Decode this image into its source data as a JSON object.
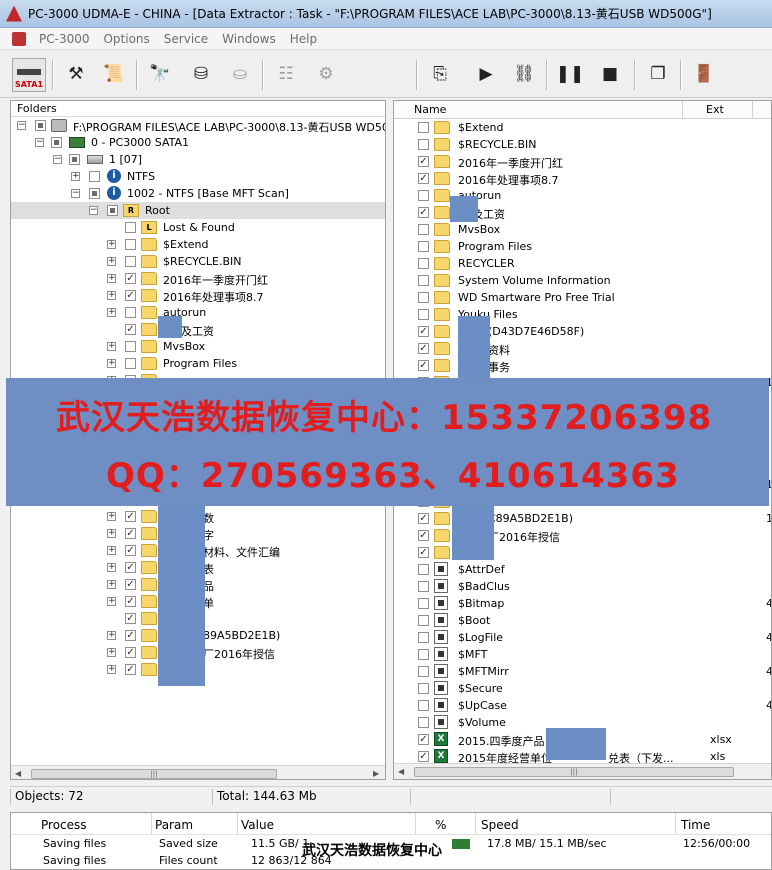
{
  "window": {
    "title": "PC-3000 UDMA-E - CHINA - [Data Extractor : Task - \"F:\\PROGRAM FILES\\ACE LAB\\PC-3000\\8.13-黄石USB WD500G\"]"
  },
  "menu": {
    "app_name": "PC-3000",
    "items": [
      "Options",
      "Service",
      "Windows",
      "Help"
    ]
  },
  "toolbar": {
    "sata_label": "SATA1"
  },
  "folders": {
    "header": "Folders",
    "rows": [
      {
        "label": "F:\\PROGRAM FILES\\ACE LAB\\PC-3000\\8.13-黄石USB WD500"
      },
      {
        "label": "0 - PC3000 SATA1"
      },
      {
        "label": "1 [07]"
      },
      {
        "label": "NTFS"
      },
      {
        "label": "1002 - NTFS [Base MFT Scan]"
      },
      {
        "label": "Root"
      },
      {
        "label": "Lost & Found"
      },
      {
        "label": "$Extend"
      },
      {
        "label": "$RECYCLE.BIN"
      },
      {
        "label": "2016年一季度开门红"
      },
      {
        "label": "2016年处理事项8.7"
      },
      {
        "label": "autorun"
      },
      {
        "label": "及工资"
      },
      {
        "label": "MvsBox"
      },
      {
        "label": "Program Files"
      },
      {
        "label": ""
      },
      {
        "label": ""
      },
      {
        "label": ""
      },
      {
        "label": ""
      },
      {
        "label": ""
      },
      {
        "label": ""
      },
      {
        "label": ""
      },
      {
        "label": ""
      },
      {
        "label": "数"
      },
      {
        "label": "字"
      },
      {
        "label": "材料、文件汇编"
      },
      {
        "label": "表"
      },
      {
        "label": "品"
      },
      {
        "label": "单"
      },
      {
        "label": ""
      },
      {
        "label": "89A5BD2E1B)"
      },
      {
        "label": "厂2016年授信"
      },
      {
        "label": ""
      }
    ]
  },
  "filelist": {
    "col_name": "Name",
    "col_ext": "Ext",
    "rows": [
      {
        "name": "$Extend",
        "ext": "",
        "edge": ""
      },
      {
        "name": "$RECYCLE.BIN",
        "ext": "",
        "edge": ""
      },
      {
        "name": "2016年一季度开门红",
        "ext": "",
        "edge": ""
      },
      {
        "name": "2016年处理事项8.7",
        "ext": "",
        "edge": ""
      },
      {
        "name": "autorun",
        "ext": "",
        "edge": ""
      },
      {
        "name": "及工资",
        "ext": "",
        "edge": ""
      },
      {
        "name": "MvsBox",
        "ext": "",
        "edge": ""
      },
      {
        "name": "Program Files",
        "ext": "",
        "edge": ""
      },
      {
        "name": "RECYCLER",
        "ext": "",
        "edge": ""
      },
      {
        "name": "System Volume Information",
        "ext": "",
        "edge": ""
      },
      {
        "name": "WD Smartware Pro Free Trial",
        "ext": "",
        "edge": ""
      },
      {
        "name": "Youku Files",
        "ext": "",
        "edge": ""
      },
      {
        "name": "(D43D7E46D58F)",
        "ext": "",
        "edge": ""
      },
      {
        "name": "资料",
        "ext": "",
        "edge": ""
      },
      {
        "name": "事务",
        "ext": "",
        "edge": ""
      },
      {
        "name": "",
        "ext": "",
        "edge": "1"
      },
      {
        "name": "",
        "ext": "",
        "edge": ""
      },
      {
        "name": "",
        "ext": "",
        "edge": ""
      },
      {
        "name": "",
        "ext": "",
        "edge": ""
      },
      {
        "name": "",
        "ext": "",
        "edge": ""
      },
      {
        "name": "",
        "ext": "",
        "edge": ""
      },
      {
        "name": "",
        "ext": "",
        "edge": "1"
      },
      {
        "name": "",
        "ext": "",
        "edge": ""
      },
      {
        "name": "C89A5BD2E1B)",
        "ext": "",
        "edge": "1"
      },
      {
        "name": "厂2016年授信",
        "ext": "",
        "edge": ""
      },
      {
        "name": "",
        "ext": "",
        "edge": ""
      },
      {
        "name": "$AttrDef",
        "ext": "",
        "edge": ""
      },
      {
        "name": "$BadClus",
        "ext": "",
        "edge": ""
      },
      {
        "name": "$Bitmap",
        "ext": "",
        "edge": "4"
      },
      {
        "name": "$Boot",
        "ext": "",
        "edge": ""
      },
      {
        "name": "$LogFile",
        "ext": "",
        "edge": "4"
      },
      {
        "name": "$MFT",
        "ext": "",
        "edge": ""
      },
      {
        "name": "$MFTMirr",
        "ext": "",
        "edge": "4"
      },
      {
        "name": "$Secure",
        "ext": "",
        "edge": ""
      },
      {
        "name": "$UpCase",
        "ext": "",
        "edge": "4"
      },
      {
        "name": "$Volume",
        "ext": "",
        "edge": ""
      },
      {
        "name": "2015.四季度产品",
        "ext": "xlsx",
        "edge": ""
      },
      {
        "name": "2015年度经营单位",
        "name2": "兑表（下发...",
        "ext": "xls",
        "edge": ""
      }
    ]
  },
  "status": {
    "objects": "Objects: 72",
    "total": "Total: 144.63 Mb"
  },
  "progress": {
    "headers": {
      "process": "Process",
      "param": "Param",
      "value": "Value",
      "percent": "%",
      "speed": "Speed",
      "time": "Time"
    },
    "rows": [
      {
        "process": "Saving files",
        "param": "Saved size",
        "value": "11.5 GB/ 1",
        "percent": "",
        "speed": "17.8 MB/ 15.1 MB/sec",
        "time": "12:56/00:00",
        "level": 0.8
      },
      {
        "process": "Saving files",
        "param": "Files count",
        "value": "12 863/12 864",
        "percent": "",
        "speed": "",
        "time": "",
        "level": 1.0
      }
    ]
  },
  "watermark": {
    "line1": "武汉天浩数据恢复中心：15337206398",
    "line2": "QQ：270569363、410614363",
    "small": "武汉天浩数据恢复中心"
  },
  "colors": {
    "banner": "#6f8ec3",
    "banner_text": "#e21d1d",
    "redact": "#6b8fc4"
  }
}
